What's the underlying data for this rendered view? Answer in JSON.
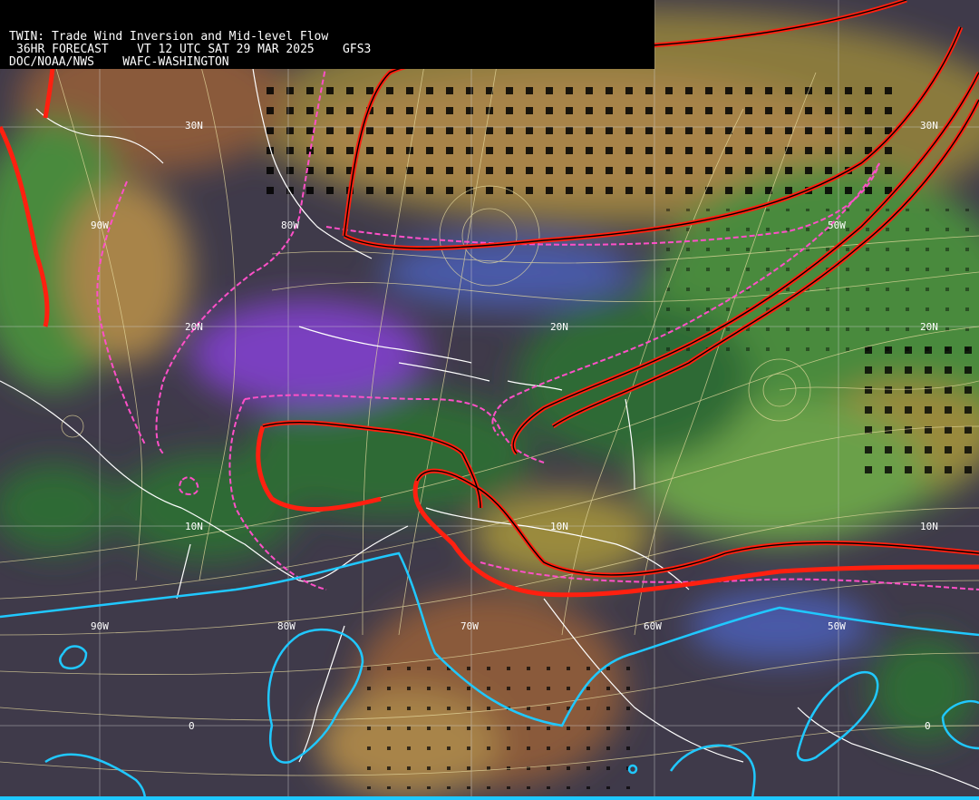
{
  "header": {
    "title": "TWIN: Trade Wind Inversion and Mid-level Flow",
    "forecast": "36HR FORECAST",
    "valid_time": "VT 12 UTC SAT 29 MAR 2025",
    "model": "GFS3",
    "agency": "DOC/NOAA/NWS",
    "center": "WAFC-WASHINGTON"
  },
  "grid_labels": {
    "lon_90w_top": "90W",
    "lon_80w_top": "80W",
    "lon_50w_top": "50W",
    "lat_30n_left": "30N",
    "lat_30n_right": "30N",
    "lat_20n_left": "20N",
    "lat_20n_mid": "20N",
    "lat_20n_right": "20N",
    "lat_10n_left": "10N",
    "lat_10n_mid": "10N",
    "lat_10n_right": "10N",
    "lon_90w_bottom": "90W",
    "lon_80w_bottom": "80W",
    "lon_70w_bottom": "70W",
    "lon_60w_bottom": "60W",
    "lon_50w_bottom": "50W",
    "eq_left": "0",
    "eq_right": "0"
  },
  "colors": {
    "background_dark": "#3f3a4a",
    "purple_band": "#7a3fc0",
    "blue_band": "#4a5aa8",
    "dark_green": "#2f6a34",
    "green": "#4a8a3c",
    "light_green": "#6aa04a",
    "olive": "#9a8a3c",
    "tan": "#a8844a",
    "brown": "#8a5a3a",
    "streamline": "#e8dca0",
    "red_contour": "#ff2010",
    "magenta_dashed": "#ff50c8",
    "cyan_contour": "#20c8ff",
    "coastline": "#ffffff"
  }
}
